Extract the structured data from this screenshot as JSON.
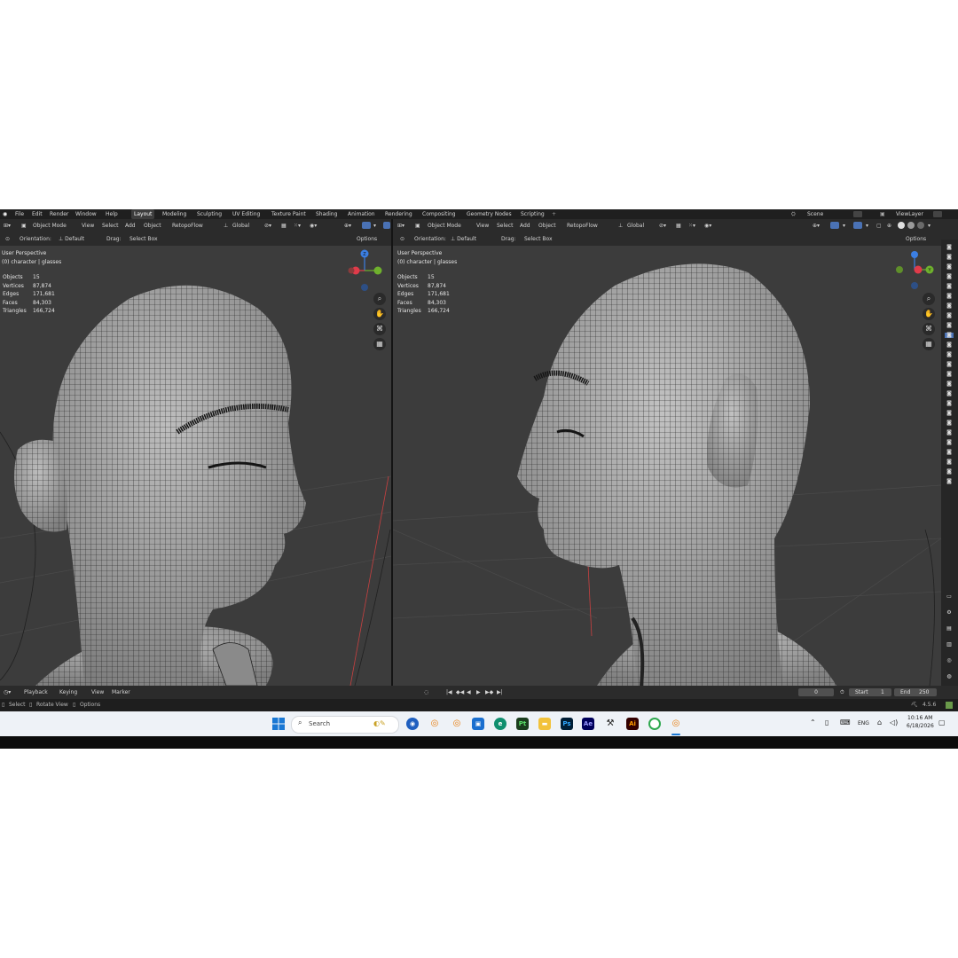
{
  "topbar": {
    "menus": [
      "File",
      "Edit",
      "Render",
      "Window",
      "Help"
    ],
    "workspaces": [
      "Layout",
      "Modeling",
      "Sculpting",
      "UV Editing",
      "Texture Paint",
      "Shading",
      "Animation",
      "Rendering",
      "Compositing",
      "Geometry Nodes",
      "Scripting"
    ],
    "active_workspace": "Layout",
    "add_tab": "+",
    "scene": "Scene",
    "view_layer": "ViewLayer"
  },
  "viewport_left": {
    "mode": "Object Mode",
    "menus": [
      "View",
      "Select",
      "Add",
      "Object"
    ],
    "addon": "RetopoFlow",
    "transform": "Global",
    "orientation_label": "Orientation:",
    "orientation_value": "Default",
    "drag_label": "Drag:",
    "drag_value": "Select Box",
    "options": "Options",
    "view_name": "User Perspective",
    "collection": "(0) character | glasses",
    "stats": [
      {
        "label": "Objects",
        "value": "15"
      },
      {
        "label": "Vertices",
        "value": "87,874"
      },
      {
        "label": "Edges",
        "value": "171,681"
      },
      {
        "label": "Faces",
        "value": "84,303"
      },
      {
        "label": "Triangles",
        "value": "166,724"
      }
    ]
  },
  "viewport_right": {
    "mode": "Object Mode",
    "menus": [
      "View",
      "Select",
      "Add",
      "Object"
    ],
    "addon": "RetopoFlow",
    "transform": "Global",
    "orientation_label": "Orientation:",
    "orientation_value": "Default",
    "drag_label": "Drag:",
    "drag_value": "Select Box",
    "options": "Options",
    "view_name": "User Perspective",
    "collection": "(0) character | glasses",
    "stats": [
      {
        "label": "Objects",
        "value": "15"
      },
      {
        "label": "Vertices",
        "value": "87,874"
      },
      {
        "label": "Edges",
        "value": "171,681"
      },
      {
        "label": "Faces",
        "value": "84,303"
      },
      {
        "label": "Triangles",
        "value": "166,724"
      }
    ]
  },
  "gizmo": {
    "z": "Z",
    "y": "Y",
    "x": "X"
  },
  "timeline": {
    "menus": [
      "Playback",
      "Keying",
      "View",
      "Marker"
    ],
    "current_frame": "0",
    "start_label": "Start",
    "start_value": "1",
    "end_label": "End",
    "end_value": "250"
  },
  "statusbar": {
    "items": [
      "Select",
      "Rotate View",
      "Options"
    ],
    "version": "4.5.6"
  },
  "taskbar": {
    "search_placeholder": "Search",
    "apps": [
      {
        "name": "blender",
        "label": "",
        "color": "#e87d0d"
      },
      {
        "name": "pt",
        "label": "Pt",
        "color": "#1a3d1d"
      },
      {
        "name": "ps",
        "label": "Ps",
        "color": "#001e36"
      },
      {
        "name": "ae",
        "label": "Ae",
        "color": "#00005b"
      },
      {
        "name": "ai",
        "label": "Ai",
        "color": "#330000"
      }
    ],
    "language": "ENG",
    "time": "10:16 AM",
    "date": "6/18/2026"
  },
  "colors": {
    "viewport_bg": "#3c3c3c",
    "header_bg": "#2b2b2b",
    "axis_x": "#e03b4a",
    "axis_y": "#6fb12d",
    "axis_z": "#3b7fe3",
    "taskbar_bg": "#eef2f7"
  }
}
